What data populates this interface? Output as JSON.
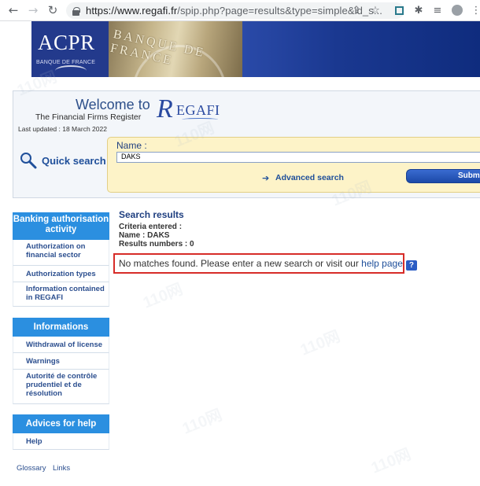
{
  "browser": {
    "url_host": "https://www.regafi.fr",
    "url_path": "/spip.php?page=results&type=simple&id_s..."
  },
  "header": {
    "logo_text": "ACPR",
    "logo_sub": "BANQUE DE FRANCE",
    "photo_text": "BANQUE DE FRANCE"
  },
  "welcome": {
    "title": "Welcome to",
    "subtitle": "The Financial Firms Register",
    "brand_R": "R",
    "brand_rest": "EGAFI",
    "updated": "Last updated : 18 March 2022"
  },
  "quick_search": {
    "label": "Quick search",
    "name_label": "Name :",
    "name_value": "DAKS",
    "advanced_label": "Advanced search",
    "submit_label": "Submit"
  },
  "sidebar": {
    "section1_title": "Banking authorisation activity",
    "section1_items": [
      "Authorization on financial sector",
      "Authorization types",
      "Information contained in REGAFI"
    ],
    "section2_title": "Informations",
    "section2_items": [
      "Withdrawal of license",
      "Warnings",
      "Autorité de contrôle prudentiel et de résolution"
    ],
    "section3_title": "Advices for help",
    "section3_items": [
      "Help"
    ],
    "footer_links": [
      "Glossary",
      "Links"
    ]
  },
  "results": {
    "title": "Search results",
    "criteria": "Criteria entered :",
    "name_line": "Name : DAKS",
    "count_line": "Results numbers : 0",
    "nomatch_text": "No matches found. Please enter a new search or visit our ",
    "help_link": "help page",
    "help_icon": "?"
  },
  "watermark": "110网",
  "colors": {
    "accent_blue": "#2b8fe0",
    "link_blue": "#1f4f9a",
    "alert_red": "#d72c28",
    "search_bg": "#fdf3c8"
  }
}
